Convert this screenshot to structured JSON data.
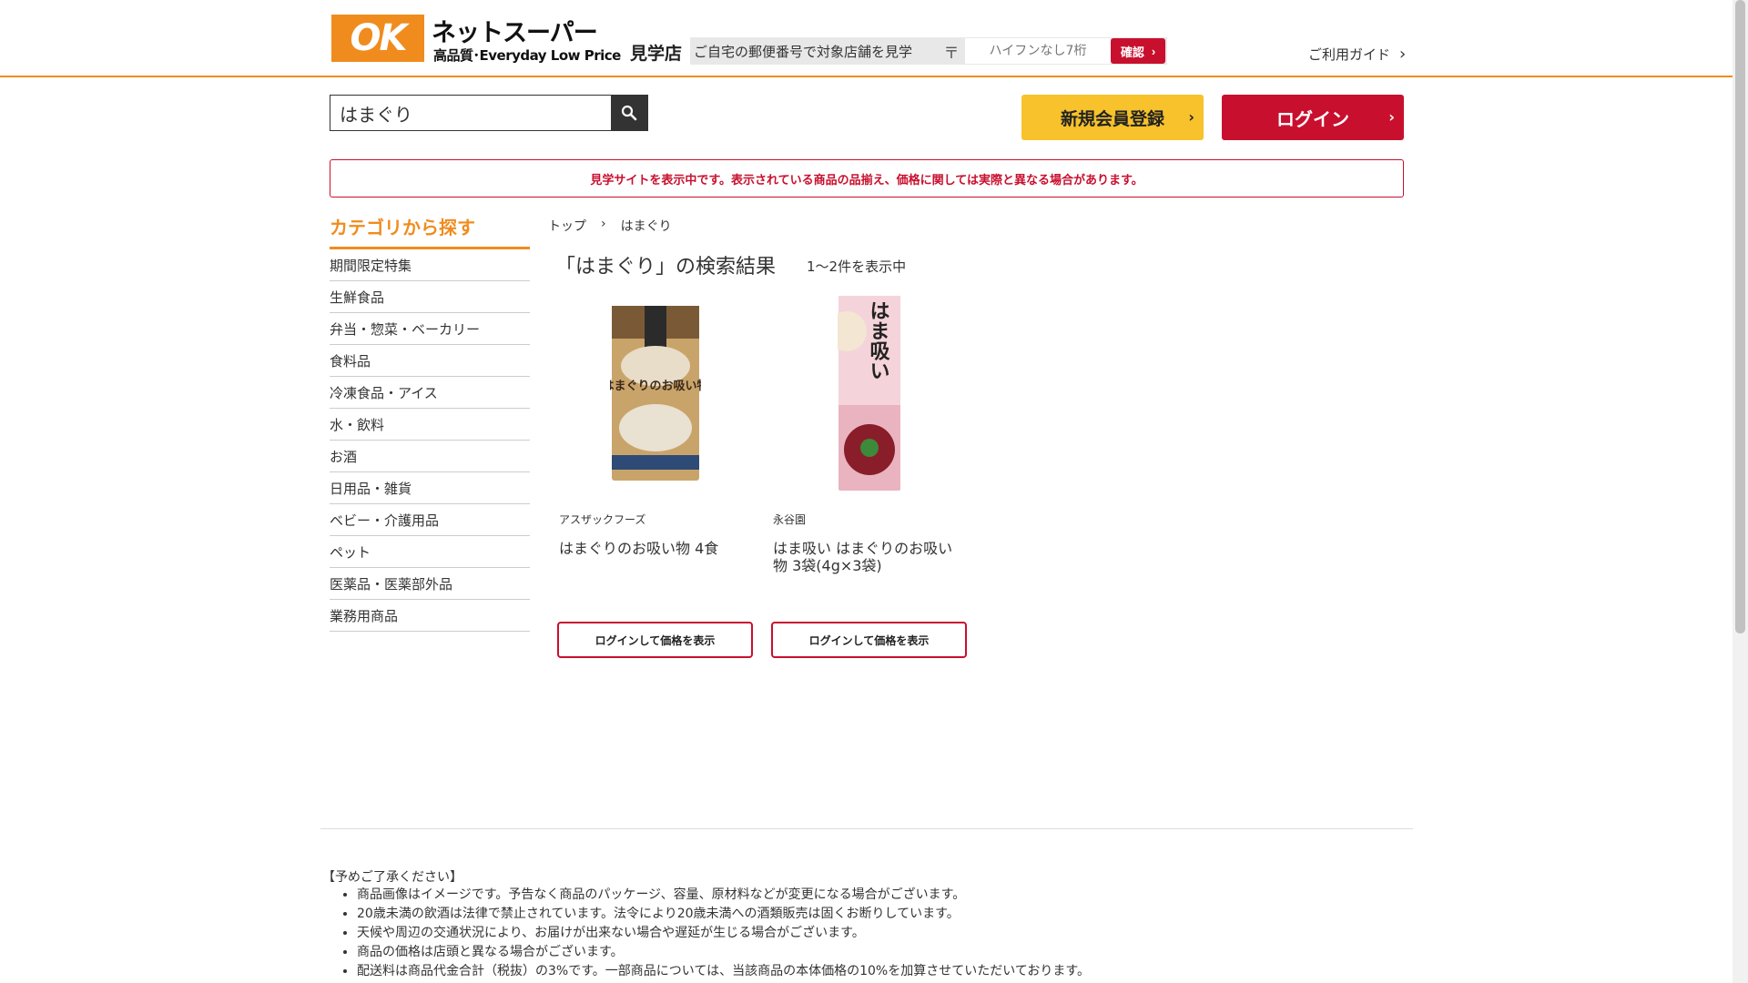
{
  "header": {
    "logo_text": "OK",
    "site_name": "ネットスーパー",
    "tagline": "高品質･Everyday Low Price",
    "store_label": "見学店",
    "zip_prompt": "ご自宅の郵便番号で対象店舗を見学",
    "zip_mark": "〒",
    "zip_placeholder": "ハイフンなし7桁",
    "confirm_label": "確認",
    "guide_label": "ご利用ガイド"
  },
  "search": {
    "value": "はまぐり"
  },
  "account": {
    "register_label": "新規会員登録",
    "login_label": "ログイン"
  },
  "notice": "見学サイトを表示中です。表示されている商品の品揃え、価格に関しては実際と異なる場合があります。",
  "sidebar": {
    "title": "カテゴリから探す",
    "items": [
      "期間限定特集",
      "生鮮食品",
      "弁当・惣菜・ベーカリー",
      "食料品",
      "冷凍食品・アイス",
      "水・飲料",
      "お酒",
      "日用品・雑貨",
      "ベビー・介護用品",
      "ペット",
      "医薬品・医薬部外品",
      "業務用商品"
    ]
  },
  "breadcrumb": {
    "home": "トップ",
    "separator": "›",
    "current": "はまぐり"
  },
  "results": {
    "title": "「はまぐり」の検索結果",
    "count": "1〜2件を表示中"
  },
  "products": [
    {
      "brand": "アスザックフーズ",
      "name": "はまぐりのお吸い物 4食",
      "button_label": "ログインして価格を表示",
      "package_text": "はまぐりのお吸い物"
    },
    {
      "brand": "永谷園",
      "name": "はま吸い はまぐりのお吸い物 3袋(4g×3袋)",
      "button_label": "ログインして価格を表示",
      "package_text": "はま吸い"
    }
  ],
  "footer": {
    "heading": "【予めご了承ください】",
    "notes": [
      "商品画像はイメージです。予告なく商品のパッケージ、容量、原材料などが変更になる場合がございます。",
      "20歳未満の飲酒は法律で禁止されています。法令により20歳未満への酒類販売は固くお断りしています。",
      "天候や周辺の交通状況により、お届けが出来ない場合や遅延が生じる場合がございます。",
      "商品の価格は店頭と異なる場合がございます。",
      "配送料は商品代金合計（税抜）の3%です。一部商品については、当該商品の本体価格の10%を加算させていただいております。"
    ]
  },
  "colors": {
    "brand_orange": "#f08c1e",
    "brand_red": "#c8102e",
    "register_yellow": "#f7c22b"
  }
}
